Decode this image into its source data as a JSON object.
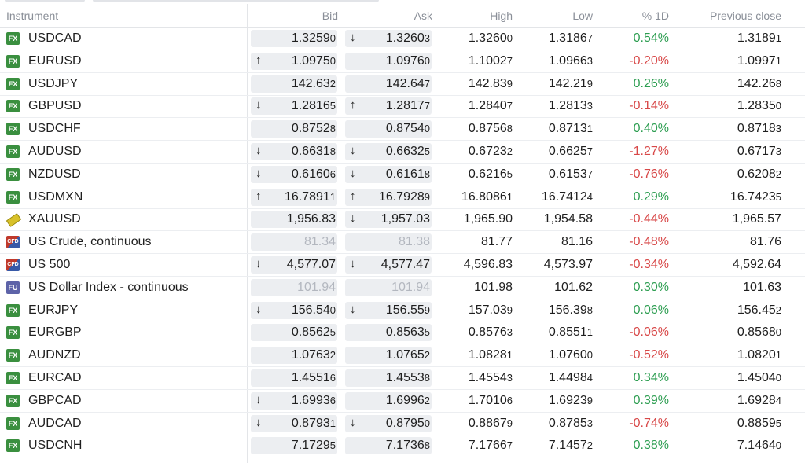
{
  "headers": {
    "instrument": "Instrument",
    "bid": "Bid",
    "ask": "Ask",
    "high": "High",
    "low": "Low",
    "change": "% 1D",
    "prev": "Previous close"
  },
  "colors": {
    "positive": "#2e9e52",
    "negative": "#d84848",
    "fx_badge": "#3a8f3f"
  },
  "rows": [
    {
      "badge": "FX",
      "name": "USDCAD",
      "bid": "1.3259",
      "bid_sub": "0",
      "bid_arrow": "",
      "ask": "1.3260",
      "ask_sub": "3",
      "ask_arrow": "↓",
      "high": "1.3260",
      "high_sub": "0",
      "low": "1.3186",
      "low_sub": "7",
      "change": "0.54%",
      "dir": "pos",
      "prev": "1.3189",
      "prev_sub": "1",
      "muted": false
    },
    {
      "badge": "FX",
      "name": "EURUSD",
      "bid": "1.0975",
      "bid_sub": "0",
      "bid_arrow": "↑",
      "ask": "1.0976",
      "ask_sub": "0",
      "ask_arrow": "",
      "high": "1.1002",
      "high_sub": "7",
      "low": "1.0966",
      "low_sub": "3",
      "change": "-0.20%",
      "dir": "neg",
      "prev": "1.0997",
      "prev_sub": "1",
      "muted": false
    },
    {
      "badge": "FX",
      "name": "USDJPY",
      "bid": "142.63",
      "bid_sub": "2",
      "bid_arrow": "",
      "ask": "142.64",
      "ask_sub": "7",
      "ask_arrow": "",
      "high": "142.83",
      "high_sub": "9",
      "low": "142.21",
      "low_sub": "9",
      "change": "0.26%",
      "dir": "pos",
      "prev": "142.26",
      "prev_sub": "8",
      "muted": false
    },
    {
      "badge": "FX",
      "name": "GBPUSD",
      "bid": "1.2816",
      "bid_sub": "5",
      "bid_arrow": "↓",
      "ask": "1.2817",
      "ask_sub": "7",
      "ask_arrow": "↑",
      "high": "1.2840",
      "high_sub": "7",
      "low": "1.2813",
      "low_sub": "3",
      "change": "-0.14%",
      "dir": "neg",
      "prev": "1.2835",
      "prev_sub": "0",
      "muted": false
    },
    {
      "badge": "FX",
      "name": "USDCHF",
      "bid": "0.8752",
      "bid_sub": "8",
      "bid_arrow": "",
      "ask": "0.8754",
      "ask_sub": "0",
      "ask_arrow": "",
      "high": "0.8756",
      "high_sub": "8",
      "low": "0.8713",
      "low_sub": "1",
      "change": "0.40%",
      "dir": "pos",
      "prev": "0.8718",
      "prev_sub": "3",
      "muted": false
    },
    {
      "badge": "FX",
      "name": "AUDUSD",
      "bid": "0.6631",
      "bid_sub": "8",
      "bid_arrow": "↓",
      "ask": "0.6632",
      "ask_sub": "5",
      "ask_arrow": "↓",
      "high": "0.6723",
      "high_sub": "2",
      "low": "0.6625",
      "low_sub": "7",
      "change": "-1.27%",
      "dir": "neg",
      "prev": "0.6717",
      "prev_sub": "3",
      "muted": false
    },
    {
      "badge": "FX",
      "name": "NZDUSD",
      "bid": "0.6160",
      "bid_sub": "6",
      "bid_arrow": "↓",
      "ask": "0.6161",
      "ask_sub": "8",
      "ask_arrow": "↓",
      "high": "0.6216",
      "high_sub": "5",
      "low": "0.6153",
      "low_sub": "7",
      "change": "-0.76%",
      "dir": "neg",
      "prev": "0.6208",
      "prev_sub": "2",
      "muted": false
    },
    {
      "badge": "FX",
      "name": "USDMXN",
      "bid": "16.7891",
      "bid_sub": "1",
      "bid_arrow": "↑",
      "ask": "16.7928",
      "ask_sub": "9",
      "ask_arrow": "↑",
      "high": "16.8086",
      "high_sub": "1",
      "low": "16.7412",
      "low_sub": "4",
      "change": "0.29%",
      "dir": "pos",
      "prev": "16.7423",
      "prev_sub": "5",
      "muted": false
    },
    {
      "badge": "GOLD",
      "name": "XAUUSD",
      "bid": "1,956.83",
      "bid_sub": "",
      "bid_arrow": "",
      "ask": "1,957.03",
      "ask_sub": "",
      "ask_arrow": "↓",
      "high": "1,965.90",
      "high_sub": "",
      "low": "1,954.58",
      "low_sub": "",
      "change": "-0.44%",
      "dir": "neg",
      "prev": "1,965.57",
      "prev_sub": "",
      "muted": false
    },
    {
      "badge": "CFD",
      "name": "US Crude, continuous",
      "bid": "81.34",
      "bid_sub": "",
      "bid_arrow": "",
      "ask": "81.38",
      "ask_sub": "",
      "ask_arrow": "",
      "high": "81.77",
      "high_sub": "",
      "low": "81.16",
      "low_sub": "",
      "change": "-0.48%",
      "dir": "neg",
      "prev": "81.76",
      "prev_sub": "",
      "muted": true
    },
    {
      "badge": "CFD",
      "name": "US 500",
      "bid": "4,577.07",
      "bid_sub": "",
      "bid_arrow": "↓",
      "ask": "4,577.47",
      "ask_sub": "",
      "ask_arrow": "↓",
      "high": "4,596.83",
      "high_sub": "",
      "low": "4,573.97",
      "low_sub": "",
      "change": "-0.34%",
      "dir": "neg",
      "prev": "4,592.64",
      "prev_sub": "",
      "muted": false
    },
    {
      "badge": "FU",
      "name": "US Dollar Index - continuous",
      "bid": "101.94",
      "bid_sub": "",
      "bid_arrow": "",
      "ask": "101.94",
      "ask_sub": "",
      "ask_arrow": "",
      "high": "101.98",
      "high_sub": "",
      "low": "101.62",
      "low_sub": "",
      "change": "0.30%",
      "dir": "pos",
      "prev": "101.63",
      "prev_sub": "",
      "muted": true
    },
    {
      "badge": "FX",
      "name": "EURJPY",
      "bid": "156.54",
      "bid_sub": "0",
      "bid_arrow": "↓",
      "ask": "156.55",
      "ask_sub": "9",
      "ask_arrow": "↓",
      "high": "157.03",
      "high_sub": "9",
      "low": "156.39",
      "low_sub": "8",
      "change": "0.06%",
      "dir": "pos",
      "prev": "156.45",
      "prev_sub": "2",
      "muted": false
    },
    {
      "badge": "FX",
      "name": "EURGBP",
      "bid": "0.8562",
      "bid_sub": "5",
      "bid_arrow": "",
      "ask": "0.8563",
      "ask_sub": "5",
      "ask_arrow": "",
      "high": "0.8576",
      "high_sub": "3",
      "low": "0.8551",
      "low_sub": "1",
      "change": "-0.06%",
      "dir": "neg",
      "prev": "0.8568",
      "prev_sub": "0",
      "muted": false
    },
    {
      "badge": "FX",
      "name": "AUDNZD",
      "bid": "1.0763",
      "bid_sub": "2",
      "bid_arrow": "",
      "ask": "1.0765",
      "ask_sub": "2",
      "ask_arrow": "",
      "high": "1.0828",
      "high_sub": "1",
      "low": "1.0760",
      "low_sub": "0",
      "change": "-0.52%",
      "dir": "neg",
      "prev": "1.0820",
      "prev_sub": "1",
      "muted": false
    },
    {
      "badge": "FX",
      "name": "EURCAD",
      "bid": "1.4551",
      "bid_sub": "6",
      "bid_arrow": "",
      "ask": "1.4553",
      "ask_sub": "8",
      "ask_arrow": "",
      "high": "1.4554",
      "high_sub": "3",
      "low": "1.4498",
      "low_sub": "4",
      "change": "0.34%",
      "dir": "pos",
      "prev": "1.4504",
      "prev_sub": "0",
      "muted": false
    },
    {
      "badge": "FX",
      "name": "GBPCAD",
      "bid": "1.6993",
      "bid_sub": "6",
      "bid_arrow": "↓",
      "ask": "1.6996",
      "ask_sub": "2",
      "ask_arrow": "",
      "high": "1.7010",
      "high_sub": "6",
      "low": "1.6923",
      "low_sub": "9",
      "change": "0.39%",
      "dir": "pos",
      "prev": "1.6928",
      "prev_sub": "4",
      "muted": false
    },
    {
      "badge": "FX",
      "name": "AUDCAD",
      "bid": "0.8793",
      "bid_sub": "1",
      "bid_arrow": "↓",
      "ask": "0.8795",
      "ask_sub": "0",
      "ask_arrow": "↓",
      "high": "0.8867",
      "high_sub": "9",
      "low": "0.8785",
      "low_sub": "3",
      "change": "-0.74%",
      "dir": "neg",
      "prev": "0.8859",
      "prev_sub": "5",
      "muted": false
    },
    {
      "badge": "FX",
      "name": "USDCNH",
      "bid": "7.1729",
      "bid_sub": "5",
      "bid_arrow": "",
      "ask": "7.1736",
      "ask_sub": "8",
      "ask_arrow": "",
      "high": "7.1766",
      "high_sub": "7",
      "low": "7.1457",
      "low_sub": "2",
      "change": "0.38%",
      "dir": "pos",
      "prev": "7.1464",
      "prev_sub": "0",
      "muted": false
    }
  ]
}
